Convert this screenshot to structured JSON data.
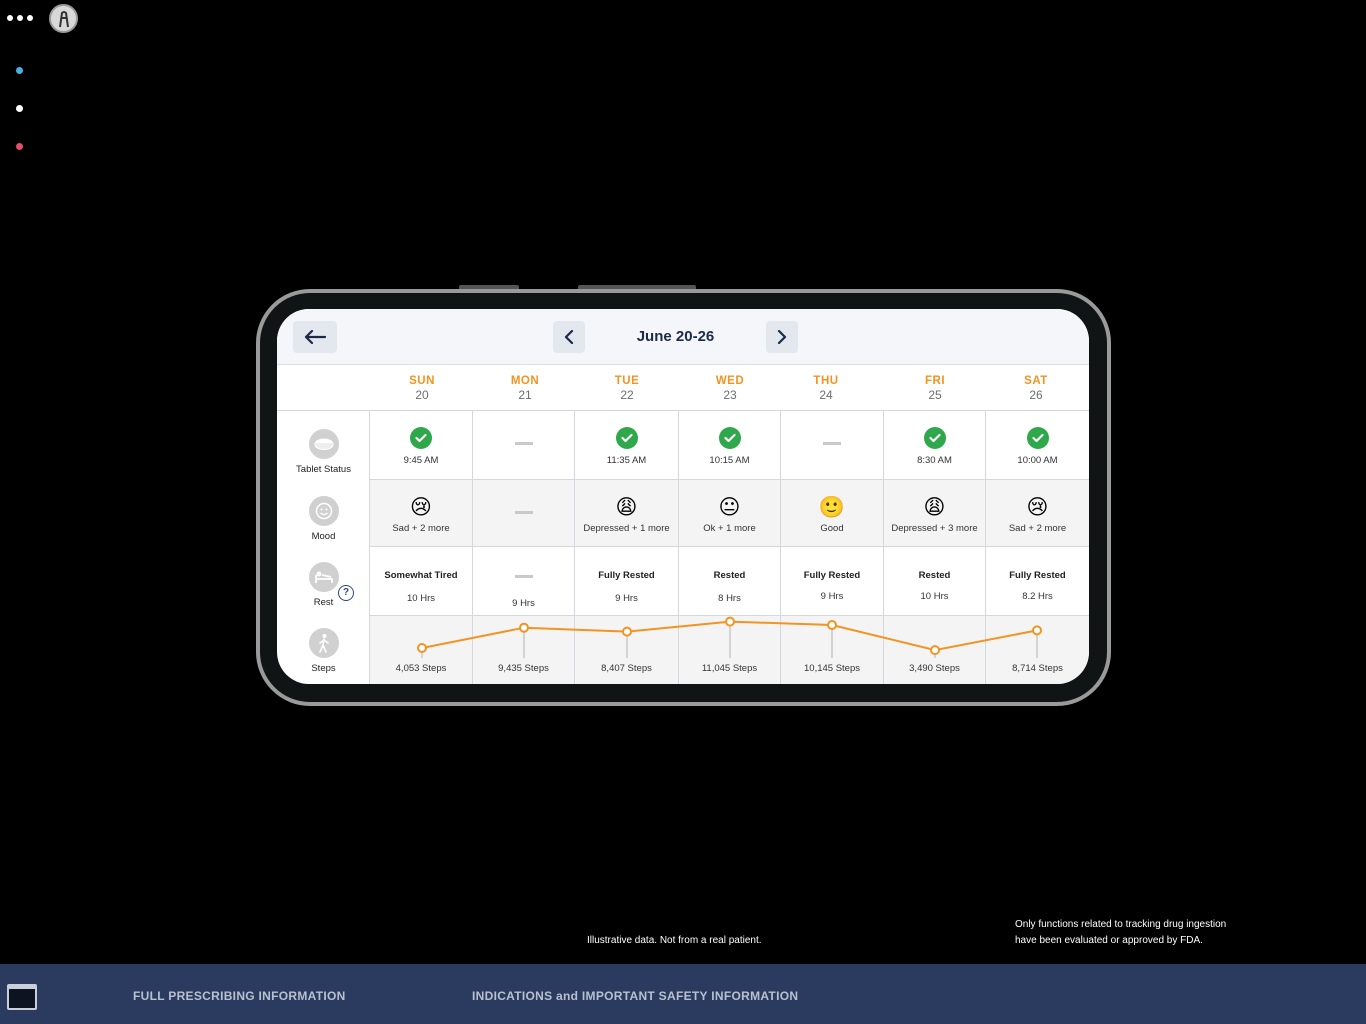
{
  "week": {
    "title": "June 20-26"
  },
  "days": [
    {
      "name": "SUN",
      "date": "20",
      "tablet_time": "9:45 AM",
      "taken": true,
      "mood_emoji": "😢",
      "mood": "Sad + 2 more",
      "rest": "Somewhat Tired",
      "hours": "10 Hrs",
      "steps_value": 4053,
      "steps": "4,053 Steps"
    },
    {
      "name": "MON",
      "date": "21",
      "tablet_time": "",
      "taken": false,
      "mood_emoji": "",
      "mood": "",
      "rest": "",
      "hours": "9 Hrs",
      "steps_value": 9435,
      "steps": "9,435 Steps"
    },
    {
      "name": "TUE",
      "date": "22",
      "tablet_time": "11:35 AM",
      "taken": true,
      "mood_emoji": "😩",
      "mood": "Depressed + 1 more",
      "rest": "Fully Rested",
      "hours": "9 Hrs",
      "steps_value": 8407,
      "steps": "8,407 Steps"
    },
    {
      "name": "WED",
      "date": "23",
      "tablet_time": "10:15 AM",
      "taken": true,
      "mood_emoji": "😐",
      "mood": "Ok + 1 more",
      "rest": "Rested",
      "hours": "8 Hrs",
      "steps_value": 11045,
      "steps": "11,045 Steps"
    },
    {
      "name": "THU",
      "date": "24",
      "tablet_time": "",
      "taken": false,
      "mood_emoji": "🙂",
      "mood": "Good",
      "rest": "Fully Rested",
      "hours": "9 Hrs",
      "steps_value": 10145,
      "steps": "10,145 Steps"
    },
    {
      "name": "FRI",
      "date": "25",
      "tablet_time": "8:30 AM",
      "taken": true,
      "mood_emoji": "😩",
      "mood": "Depressed + 3 more",
      "rest": "Rested",
      "hours": "10 Hrs",
      "steps_value": 3490,
      "steps": "3,490 Steps"
    },
    {
      "name": "SAT",
      "date": "26",
      "tablet_time": "10:00 AM",
      "taken": true,
      "mood_emoji": "😢",
      "mood": "Sad + 2 more",
      "rest": "Fully Rested",
      "hours": "8.2 Hrs",
      "steps_value": 8714,
      "steps": "8,714 Steps"
    }
  ],
  "row_labels": {
    "tablet": "Tablet Status",
    "mood": "Mood",
    "rest": "Rest",
    "steps": "Steps",
    "help": "?"
  },
  "footnotes": {
    "illustrative": "Illustrative data. Not from a real patient.",
    "fda_line1": "Only functions related to tracking drug ingestion",
    "fda_line2": "have been evaluated or approved by FDA."
  },
  "bottom_bar": {
    "prescribing": "FULL PRESCRIBING INFORMATION",
    "safety": "INDICATIONS and IMPORTANT SAFETY INFORMATION"
  },
  "colors": {
    "accent_orange": "#f39321",
    "check_green": "#2ea84a",
    "navy": "#1c2a4a",
    "dot_blue": "#4ab0e0",
    "dot_white": "#ffffff",
    "dot_red": "#e0506a",
    "bottom_bar": "#2b3a5f"
  },
  "icons": {
    "menu": "more-dots-icon",
    "logo": "logo-icon",
    "back": "arrow-left-icon",
    "prev": "chevron-left-icon",
    "next": "chevron-right-icon",
    "tablet": "pill-icon",
    "mood": "smiley-icon",
    "rest": "bed-icon",
    "steps": "walking-icon",
    "check": "check-icon"
  }
}
